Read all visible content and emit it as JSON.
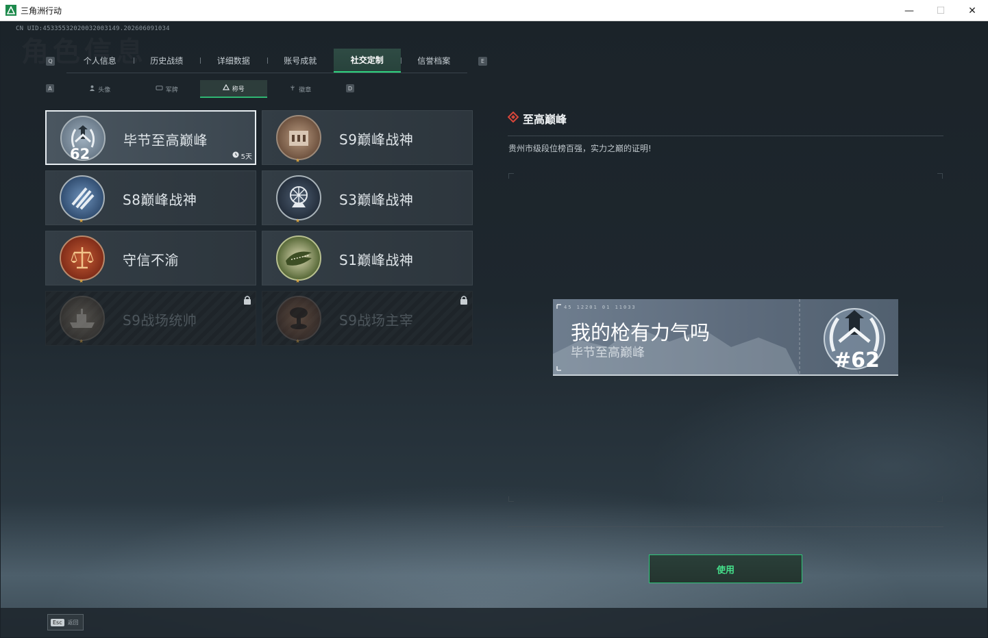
{
  "window": {
    "title": "三角洲行动",
    "minimize_glyph": "—",
    "maximize_glyph": "☐",
    "close_glyph": "✕"
  },
  "header": {
    "uid": "CN UID:4533553202003200314​9.202606091034",
    "watermark": "角色信息"
  },
  "main_tabs": {
    "key_left": "Q",
    "key_right": "E",
    "items": [
      {
        "label": "个人信息",
        "active": false
      },
      {
        "label": "历史战绩",
        "active": false
      },
      {
        "label": "详细数据",
        "active": false
      },
      {
        "label": "账号成就",
        "active": false
      },
      {
        "label": "社交定制",
        "active": true
      },
      {
        "label": "信誉档案",
        "active": false
      }
    ]
  },
  "sub_tabs": {
    "key_left": "A",
    "key_right": "D",
    "items": [
      {
        "label": "头像",
        "icon": "person-icon",
        "active": false
      },
      {
        "label": "军牌",
        "icon": "dogtag-icon",
        "active": false
      },
      {
        "label": "称号",
        "icon": "triangle-icon",
        "active": true
      },
      {
        "label": "徽章",
        "icon": "badge-icon",
        "active": false
      }
    ]
  },
  "titles": [
    {
      "name": "毕节至高巅峰",
      "rank": "62",
      "timer": "5天",
      "selected": true,
      "locked": false,
      "emblem": "peak-laurel-emblem",
      "emblem_color": "#8a9aa8"
    },
    {
      "name": "S9巅峰战神",
      "selected": false,
      "locked": false,
      "emblem": "s9-fortress-emblem",
      "emblem_color": "#7a5d48"
    },
    {
      "name": "S8巅峰战神",
      "selected": false,
      "locked": false,
      "emblem": "s8-stripes-emblem",
      "emblem_color": "#3d5e86"
    },
    {
      "name": "S3巅峰战神",
      "selected": false,
      "locked": false,
      "emblem": "s3-globe-emblem",
      "emblem_color": "#344356"
    },
    {
      "name": "守信不渝",
      "selected": false,
      "locked": false,
      "emblem": "scales-emblem",
      "emblem_color": "#9b3b22"
    },
    {
      "name": "S1巅峰战神",
      "selected": false,
      "locked": false,
      "emblem": "crocodile-emblem",
      "emblem_color": "#5b6d3a"
    },
    {
      "name": "S9战场统帅",
      "selected": false,
      "locked": true,
      "emblem": "battleship-emblem",
      "emblem_color": "#5a5148"
    },
    {
      "name": "S9战场主宰",
      "selected": false,
      "locked": true,
      "emblem": "mushroom-cloud-emblem",
      "emblem_color": "#6a4a3a"
    }
  ],
  "detail": {
    "title": "至高巅峰",
    "description": "贵州市级段位榜百强，实力之巅的证明!",
    "preview": {
      "code": "45 12201  01 11033",
      "hero_text": "我的枪有力气吗",
      "sub_text": "毕节至高巅峰",
      "rank": "#62"
    },
    "use_label": "使用"
  },
  "footer": {
    "esc_key": "Esc",
    "esc_label": "返回"
  },
  "colors": {
    "accent_green": "#2fd37f",
    "diamond_red": "#d8463a",
    "star_gold": "#d6a23d"
  }
}
